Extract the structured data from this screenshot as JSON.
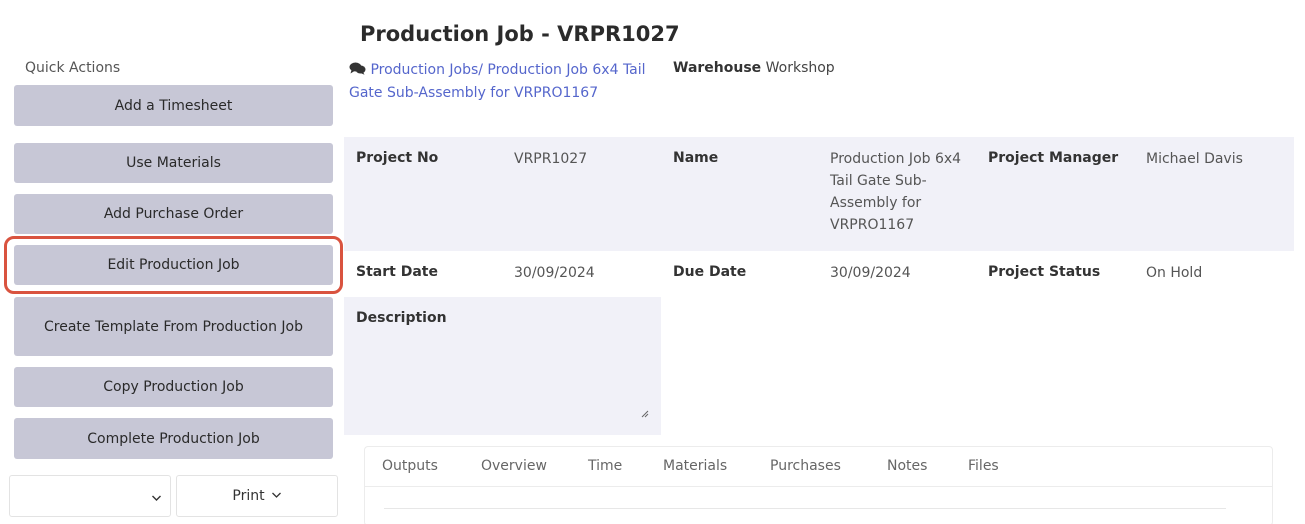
{
  "quick_actions": {
    "title": "Quick Actions",
    "buttons": [
      "Add a Timesheet",
      "Use Materials",
      "Add Purchase Order",
      "Edit Production Job",
      "Create Template From Production Job",
      "Copy Production Job",
      "Complete Production Job"
    ],
    "select_value": "",
    "print_label": "Print"
  },
  "header": {
    "title": "Production Job - VRPR1027",
    "breadcrumb": "Production Jobs/ Production Job 6x4 Tail Gate Sub-Assembly for VRPRO1167",
    "warehouse_label": "Warehouse",
    "warehouse_value": "Workshop"
  },
  "info": {
    "project_no_label": "Project No",
    "project_no": "VRPR1027",
    "name_label": "Name",
    "name": "Production Job 6x4 Tail Gate Sub-Assembly for VRPRO1167",
    "manager_label": "Project Manager",
    "manager": "Michael Davis",
    "start_label": "Start Date",
    "start": "30/09/2024",
    "due_label": "Due Date",
    "due": "30/09/2024",
    "status_label": "Project Status",
    "status": "On Hold",
    "description_label": "Description",
    "description": ""
  },
  "tabs": [
    "Outputs",
    "Overview",
    "Time",
    "Materials",
    "Purchases",
    "Notes",
    "Files"
  ],
  "colors": {
    "button_bg": "#c7c7d6",
    "highlight": "#d9533f",
    "link": "#5566cc",
    "panel_bg": "#f1f1f8"
  }
}
